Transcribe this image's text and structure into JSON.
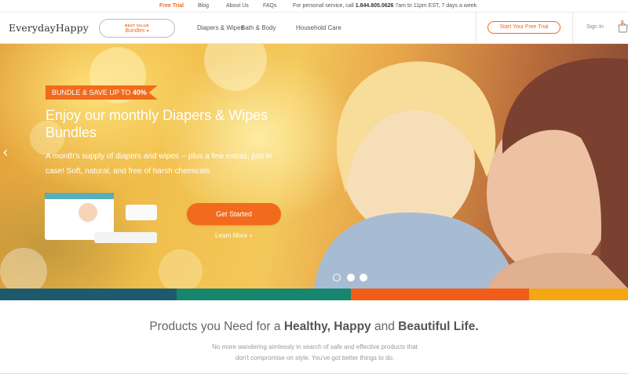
{
  "topbar": {
    "free_trial": "Free Trial",
    "blog": "Blog",
    "about": "About Us",
    "faqs": "FAQs",
    "service_prefix": "For personal service, call",
    "phone": "1.844.805.0626",
    "hours": "7am to 11pm EST, 7 days a week"
  },
  "header": {
    "logo": "EverydayHappy",
    "bundles_badge": "BEST VALUE",
    "bundles_label": "Bundles",
    "nav": [
      "Diapers & Wipes",
      "Bath & Body",
      "Household Care"
    ],
    "trial_button": "Start Your Free Trial",
    "sign_in": "Sign In",
    "cart_count": "0"
  },
  "hero": {
    "badge_text": "BUNDLE & SAVE UP TO",
    "badge_value": "40%",
    "title": "Enjoy our monthly Diapers & Wipes Bundles",
    "subtitle": "A month's supply of diapers and wipes -- plus a few extras, just in case! Soft, natural, and free of harsh chemicals.",
    "cta": "Get Started",
    "learn_more": "Learn More +",
    "slides": 3,
    "active_slide": 2
  },
  "stripes": [
    "#1d5a6e",
    "#16866f",
    "#f25c19",
    "#f4a712"
  ],
  "section": {
    "title_prefix": "Products you Need for a",
    "healthy": "Healthy,",
    "happy": "Happy",
    "and": "and",
    "beautiful": "Beautiful Life.",
    "subtitle": "No more wandering aimlessly in search of safe and effective products that don't compromise on style. You've got better things to do."
  },
  "colors": {
    "accent": "#f26a1b"
  }
}
